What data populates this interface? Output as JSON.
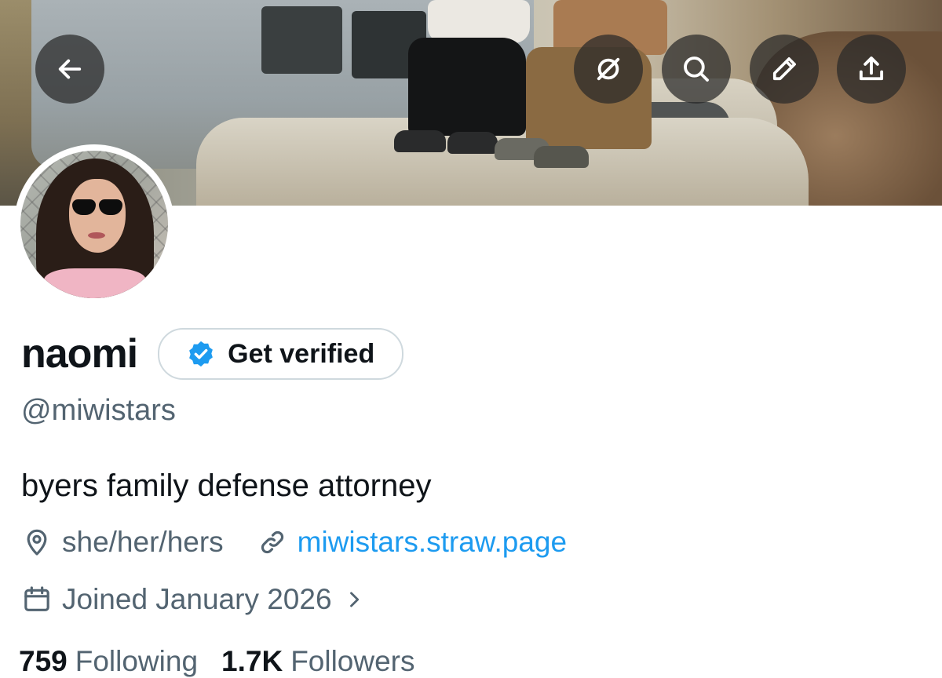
{
  "banner": {
    "back_icon": "arrow-left-icon",
    "actions": [
      {
        "icon": "grok-icon"
      },
      {
        "icon": "search-icon"
      },
      {
        "icon": "pencil-icon"
      },
      {
        "icon": "share-icon"
      }
    ]
  },
  "profile": {
    "display_name": "naomi",
    "verify_label": "Get verified",
    "handle": "@miwistars",
    "bio": "byers family defense attorney",
    "location": "she/her/hers",
    "website": "miwistars.straw.page",
    "joined": "Joined January 2026"
  },
  "stats": {
    "following_count": "759",
    "following_label": "Following",
    "followers_count": "1.7K",
    "followers_label": "Followers"
  },
  "colors": {
    "accent": "#1d9bf0",
    "secondary_text": "#536471",
    "primary_text": "#0f1419"
  }
}
